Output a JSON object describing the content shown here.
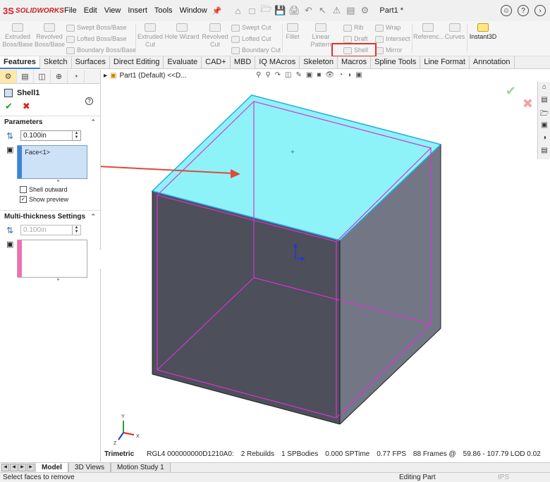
{
  "app": {
    "logo_ds": "3S",
    "logo_text": "SOLIDWORKS",
    "part_name": "Part1 *"
  },
  "menu": [
    "File",
    "Edit",
    "View",
    "Insert",
    "Tools",
    "Window"
  ],
  "ribbon": {
    "extruded_boss": "Extruded Boss/Base",
    "revolved_boss": "Revolved Boss/Base",
    "swept_boss": "Swept Boss/Base",
    "lofted_boss": "Lofted Boss/Base",
    "boundary_boss": "Boundary Boss/Base",
    "extruded_cut": "Extruded Cut",
    "hole_wizard": "Hole Wizard",
    "revolved_cut": "Revolved Cut",
    "swept_cut": "Swept Cut",
    "lofted_cut": "Lofted Cut",
    "boundary_cut": "Boundary Cut",
    "fillet": "Fillet",
    "linear_pattern": "Linear Pattern",
    "rib": "Rib",
    "wrap": "Wrap",
    "draft": "Draft",
    "intersect": "Intersect",
    "shell": "Shell",
    "mirror": "Mirror",
    "reference": "Referenc...",
    "curves": "Curves",
    "instant3d": "Instant3D"
  },
  "tabs": [
    "Features",
    "Sketch",
    "Surfaces",
    "Direct Editing",
    "Evaluate",
    "CAD+",
    "MBD",
    "IQ MAcros",
    "Skeleton",
    "Macros",
    "Spline Tools",
    "Line Format",
    "Annotation"
  ],
  "property_manager": {
    "title": "Shell1",
    "parameters_label": "Parameters",
    "thickness": "0.100in",
    "faces_selected": "Face<1>",
    "shell_outward_label": "Shell outward",
    "shell_outward_checked": false,
    "show_preview_label": "Show preview",
    "show_preview_checked": true,
    "multi_label": "Multi-thickness Settings",
    "multi_thickness": "0.100in"
  },
  "viewport": {
    "breadcrumb": "Part1 (Default) <<D...",
    "view_orientation": "Trimetric",
    "status_items": [
      "RGL4 000000000D1210A0:",
      "2 Rebuilds",
      "1 SPBodies",
      "0.000 SPTime",
      "0.77 FPS",
      "88 Frames @",
      "59.86 - 107.79 LOD 0.02"
    ]
  },
  "bottom_tabs": [
    "Model",
    "3D Views",
    "Motion Study 1"
  ],
  "status_bar": {
    "left": "Select faces to remove",
    "mode": "Editing Part",
    "units": "IPS"
  },
  "colors": {
    "top_face": "#8ef3f8",
    "front_face": "#4d4f5a",
    "right_face": "#737785",
    "edge": "#d633d6",
    "highlight": "#e03030",
    "arrow": "#e04a3a"
  }
}
